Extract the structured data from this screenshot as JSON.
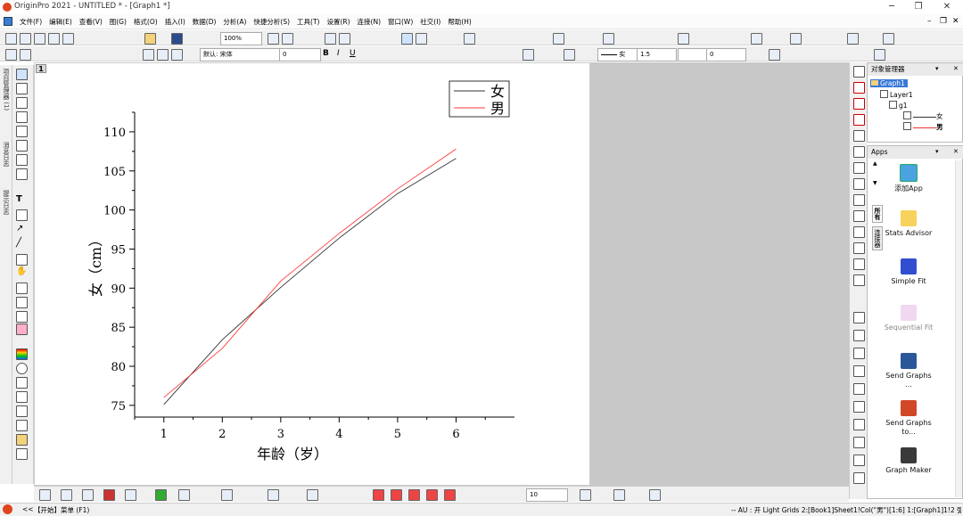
{
  "window": {
    "title": "OriginPro 2021 - UNTITLED * - [Graph1 *]",
    "controls": [
      "─",
      "❐",
      "✕"
    ]
  },
  "menu": [
    "文件(F)",
    "编辑(E)",
    "查看(V)",
    "图(G)",
    "格式(O)",
    "插入(I)",
    "数据(D)",
    "分析(A)",
    "快捷分析(S)",
    "工具(T)",
    "设置(R)",
    "连接(N)",
    "窗口(W)",
    "社交(I)",
    "帮助(H)"
  ],
  "toolbar": {
    "zoom": "100%",
    "font_name": "默认: 宋体",
    "font_size": "0",
    "line_style": "实",
    "line_width": "1.5",
    "symbol_size": "0",
    "bottom_size": "10"
  },
  "left_tabs": [
    "项目管理器 (1)",
    "消息日志",
    "提示日志"
  ],
  "layer_tab": "1",
  "object_manager": {
    "title": "对象管理器",
    "graph": "Graph1",
    "layer": "Layer1",
    "group": "g1",
    "plots": [
      "女",
      "男"
    ]
  },
  "apps": {
    "title": "Apps",
    "tabs": [
      "所有",
      "连接器"
    ],
    "items": [
      "添加App",
      "Stats Advisor",
      "Simple Fit",
      "Sequential Fit",
      "Send Graphs ...",
      "Send Graphs to...",
      "Graph Maker"
    ]
  },
  "status": {
    "start": "【开始】菜单 (F1)",
    "right": "--   AU : 开  Light Grids  2:[Book1]Sheet1!Col(\"男\")[1:6]  1:[Graph1]1!2  弧度"
  },
  "colors": {
    "female_line": "#333333",
    "male_line": "#ff3b3b",
    "page_bg": "#ffffff",
    "workspace_bg": "#c8c8c8"
  },
  "chart_data": {
    "type": "line",
    "xlabel": "年龄（岁）",
    "ylabel": "女（cm）",
    "x": [
      1,
      2,
      3,
      4,
      5,
      6
    ],
    "xticks": [
      "1",
      "2",
      "3",
      "4",
      "5",
      "6"
    ],
    "yticks": [
      "75",
      "80",
      "85",
      "90",
      "95",
      "100",
      "105",
      "110"
    ],
    "xlim": [
      0.5,
      7.0
    ],
    "ylim": [
      73.5,
      112.5
    ],
    "legend_position": "top-right",
    "series": [
      {
        "name": "女",
        "values": [
          75.1,
          83.4,
          90.1,
          96.4,
          102.1,
          106.6
        ]
      },
      {
        "name": "男",
        "values": [
          76.0,
          82.3,
          90.9,
          97.0,
          102.7,
          107.8
        ]
      }
    ]
  }
}
